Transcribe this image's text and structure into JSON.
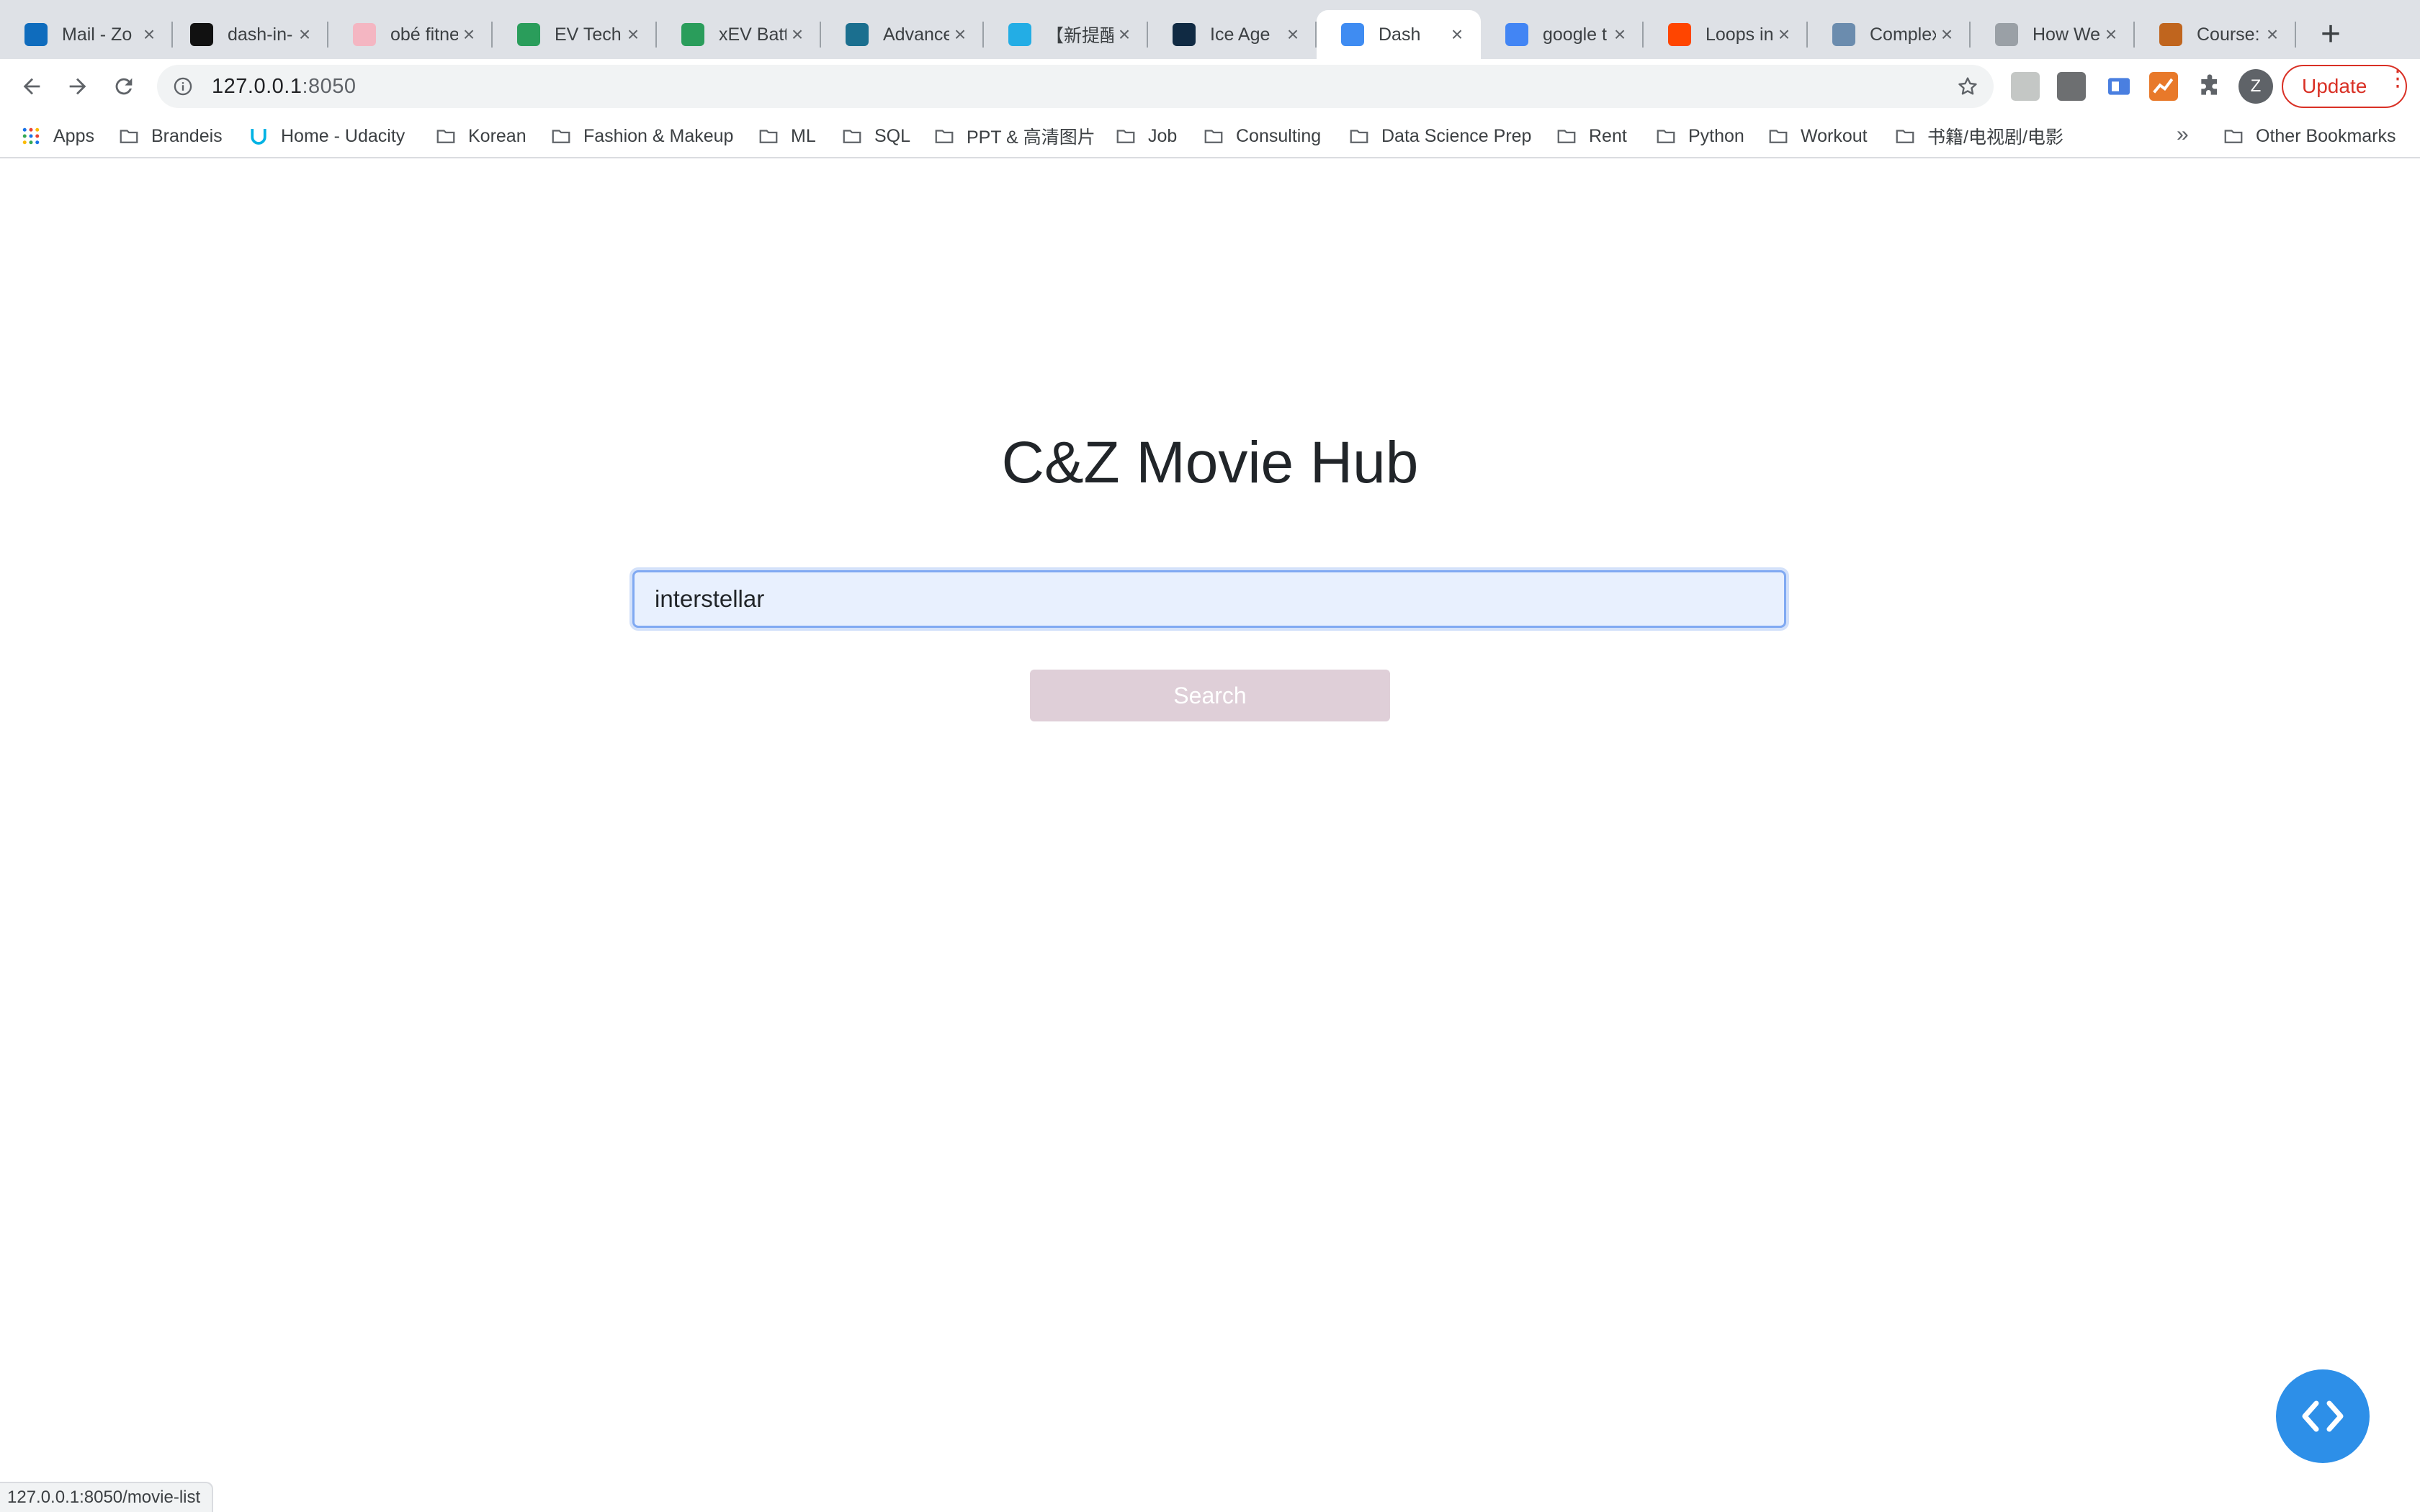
{
  "browser": {
    "tabs": [
      {
        "title": "Mail - Zo",
        "icon": "outlook-icon",
        "color": "#0f6cbd",
        "active": false
      },
      {
        "title": "dash-in-",
        "icon": "github-icon",
        "color": "#111111",
        "active": false
      },
      {
        "title": "obé fitne",
        "icon": "obe-icon",
        "color": "#f4b6c2",
        "active": false
      },
      {
        "title": "EV Techn",
        "icon": "oo-icon",
        "color": "#2a9d5b",
        "active": false
      },
      {
        "title": "xEV Batt",
        "icon": "oo-icon",
        "color": "#2a9d5b",
        "active": false
      },
      {
        "title": "Advance",
        "icon": "advance-icon",
        "color": "#1b6f8f",
        "active": false
      },
      {
        "title": "【新提醒",
        "icon": "bilibili-icon",
        "color": "#23ade5",
        "active": false
      },
      {
        "title": "Ice Age",
        "icon": "iceage-icon",
        "color": "#102a43",
        "active": false
      },
      {
        "title": "Dash",
        "icon": "dash-icon",
        "color": "#3f8cf2",
        "active": true
      },
      {
        "title": "google t",
        "icon": "google-icon",
        "color": "#4285f4",
        "active": false
      },
      {
        "title": "Loops in",
        "icon": "reddit-icon",
        "color": "#ff4500",
        "active": false
      },
      {
        "title": "Complex",
        "icon": "webpage-icon",
        "color": "#6b8cae",
        "active": false
      },
      {
        "title": "How We",
        "icon": "medium-icon",
        "color": "#9aa0a6",
        "active": false
      },
      {
        "title": "Course:",
        "icon": "course-icon",
        "color": "#c0651e",
        "active": false
      }
    ],
    "new_tab_label": "+",
    "close_glyph": "×",
    "url_host": "127.0.0.1",
    "url_port": ":8050",
    "avatar_initial": "Z",
    "update_label": "Update",
    "update_color": "#d93025",
    "bookmarks": [
      {
        "label": "Apps",
        "icon": "apps-grid-icon"
      },
      {
        "label": "Brandeis",
        "icon": "folder-icon"
      },
      {
        "label": "Home - Udacity",
        "icon": "udacity-icon"
      },
      {
        "label": "Korean",
        "icon": "folder-icon"
      },
      {
        "label": "Fashion & Makeup",
        "icon": "folder-icon"
      },
      {
        "label": "ML",
        "icon": "folder-icon"
      },
      {
        "label": "SQL",
        "icon": "folder-icon"
      },
      {
        "label": "PPT & 高清图片",
        "icon": "folder-icon"
      },
      {
        "label": "Job",
        "icon": "folder-icon"
      },
      {
        "label": "Consulting",
        "icon": "folder-icon"
      },
      {
        "label": "Data Science Prep",
        "icon": "folder-icon"
      },
      {
        "label": "Rent",
        "icon": "folder-icon"
      },
      {
        "label": "Python",
        "icon": "folder-icon"
      },
      {
        "label": "Workout",
        "icon": "folder-icon"
      },
      {
        "label": "书籍/电视剧/电影",
        "icon": "folder-icon"
      }
    ],
    "bookmarks_overflow": "»",
    "other_bookmarks": "Other Bookmarks",
    "status_url": "127.0.0.1:8050/movie-list"
  },
  "page": {
    "title": "C&Z Movie Hub",
    "search_value": "interstellar",
    "search_button_label": "Search",
    "button_color": "#dfcfd8",
    "accent": "#2d8fe8"
  }
}
